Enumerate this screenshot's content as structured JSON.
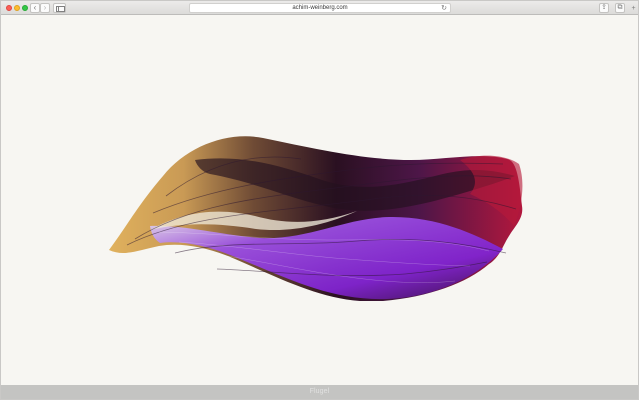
{
  "browser": {
    "address": "achim-weinberg.com",
    "icons": {
      "back": "chevron-left-icon",
      "forward": "chevron-right-icon",
      "sidebar": "sidebar-icon",
      "reload": "reload-icon",
      "share": "share-icon",
      "tabs": "tabs-icon",
      "newtab": "plus-icon"
    },
    "glyphs": {
      "back": "‹",
      "forward": "›",
      "reload": "↻",
      "share": "⇪",
      "tabs": "⧉",
      "newtab": "+"
    }
  },
  "page": {
    "footer_label": "Flugel"
  },
  "colors": {
    "background": "#f7f6f2",
    "footer": "#c4c4c2",
    "petal_gold": "#d6a24f",
    "petal_purple": "#8e2fd3",
    "petal_dark": "#2a1021",
    "petal_red": "#a8163b"
  }
}
